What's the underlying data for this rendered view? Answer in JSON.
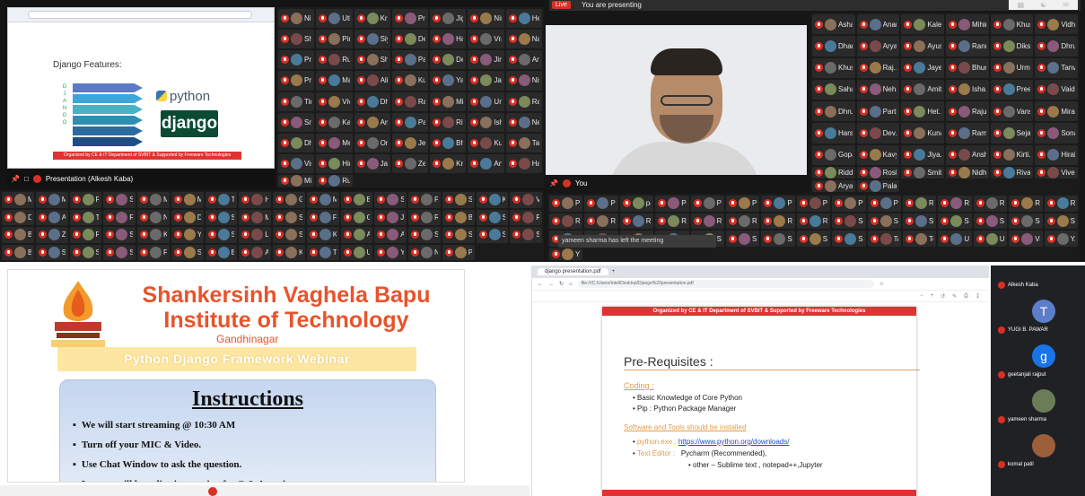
{
  "q1": {
    "slide_title": "Django Features:",
    "letters": [
      "D",
      "J",
      "A",
      "N",
      "G",
      "O"
    ],
    "arrow_colors": [
      "#5b7ac7",
      "#3ba6d8",
      "#47b3c5",
      "#2f8fb2",
      "#2c6aa0",
      "#1f4e86"
    ],
    "python_label": "python",
    "django_label": "django",
    "footer": "Organized by CE & IT Department of SVBIT & Supported by Freeware Technologies",
    "presentation_label": "Presentation (Alkesh Kaba)",
    "participants": [
      "Nikhil...",
      "Utkal...",
      "Kria...",
      "Pratas...",
      "Jigar...",
      "Nimit...",
      "Hetal...",
      "Sheja...",
      "Pinal...",
      "Siya...",
      "Deep...",
      "Harsh...",
      "Vraj...",
      "Nand...",
      "Pran...",
      "Rush...",
      "Shah...",
      "Patel...",
      "Dev...",
      "Jinal...",
      "Anish...",
      "Priy...",
      "Mahi...",
      "Alia...",
      "Kush...",
      "Yash...",
      "Jay...",
      "Nisha...",
      "Tirth...",
      "Vivek...",
      "Dhaval...",
      "Raj...",
      "Mitesh...",
      "Urvi...",
      "Rahul...",
      "Sneha...",
      "Karan...",
      "Aman...",
      "Parth...",
      "Riya...",
      "Ishan...",
      "Neel...",
      "Dhruv...",
      "Meet...",
      "Om...",
      "Jeel...",
      "Bhavik...",
      "Kunal...",
      "Tanya...",
      "Vishal...",
      "Hiren...",
      "Janvi...",
      "Zeel...",
      "Krish...",
      "Ankit...",
      "Harsh...",
      "Mitul...",
      "Rudra..."
    ],
    "bottom_participants": [
      "Man...",
      "MAN...",
      "Ram...",
      "Suhas...",
      "MAN...",
      "MAN...",
      "Thaul...",
      "Hemy...",
      "Gavest...",
      "MUCH...",
      "Bhosal...",
      "SOCH...",
      "PAVIT...",
      "SOCH...",
      "KAIMLI...",
      "Vivek...",
      "Drish...",
      "Ayush...",
      "Tarun...",
      "Ritik...",
      "Nirav...",
      "Devi...",
      "Sahil...",
      "Mansi...",
      "Sweta...",
      "Foram...",
      "Gauri...",
      "Jinal...",
      "Ronak...",
      "Bhumi...",
      "Surv...",
      "Rajat...",
      "Bawr...",
      "ZAK...",
      "Ritesh...",
      "SHAK...",
      "Kinjal...",
      "Yash...",
      "SUB...",
      "Lach...",
      "Sanil...",
      "Kevin...",
      "Arya...",
      "Akash...",
      "Shivu...",
      "Shrel...",
      "Stav...",
      "SHR...",
      "Boot...",
      "Shild...",
      "Shrit...",
      "Samir...",
      "Fahe...",
      "Sima...",
      "Bhavi...",
      "Amit...",
      "Kruti...",
      "Tirth...",
      "Ujvi...",
      "Yoshi...",
      "Nirali...",
      "Parth..."
    ]
  },
  "q2": {
    "live_label": "Live",
    "presenting": "You are presenting",
    "you_label": "You",
    "toast": "yameen sharma has left the meeting",
    "participants": [
      "Asha...",
      "Anand...",
      "Kalesh...",
      "Mihir...",
      "Khushi...",
      "Vidhi...",
      "Dhar...",
      "Arya...",
      "Ayush...",
      "Ranu...",
      "Diksha...",
      "Dhruvi...",
      "Khush...",
      "Raj...",
      "Jayesh...",
      "Bhumi...",
      "Urmi...",
      "Tanvi...",
      "Sahaj...",
      "Neha...",
      "Amit...",
      "Isha...",
      "Preet...",
      "Vaid...",
      "Dhruv...",
      "Parth...",
      "Het...",
      "Raju...",
      "Vanshi...",
      "Mira...",
      "Harsh...",
      "Dev...",
      "Kunal...",
      "Ramesh...",
      "Sejal...",
      "Sonal...",
      "Gopal...",
      "Kavya...",
      "Jiya...",
      "Ansh...",
      "Kirti...",
      "Hiral...",
      "Riddhi...",
      "Roshni...",
      "Smit...",
      "Nidhi...",
      "Riva...",
      "Vivek...",
      "Aryan...",
      "Palak..."
    ],
    "bottom": [
      "Parth L...",
      "Patel K...",
      "patel s...",
      "Patel Y...",
      "Prak...",
      "PRAKR...",
      "Prerna...",
      "Pratiksha...",
      "PRATI...",
      "Preethi...",
      "RATH...",
      "Radhika...",
      "Raju S...",
      "Rakesh...",
      "Rahul...",
      "Rahul...",
      "Rahul...",
      "Raval...",
      "Rohan...",
      "Ritika...",
      "Roshni...",
      "Rudra...",
      "Rushi...",
      "Sachin...",
      "Saloni...",
      "Sanjay...",
      "Samir...",
      "Salee...",
      "Sejal...",
      "Shah...",
      "Shivani...",
      "Shrey...",
      "Shraddha...",
      "Shubh...",
      "Smit...",
      "Sneha...",
      "Sonam...",
      "Sunny...",
      "Suresh...",
      "Tanvi...",
      "Tejas...",
      "Unnati...",
      "Urvish...",
      "Vivek...",
      "YASH...",
      "Yatri..."
    ]
  },
  "q3": {
    "title_line1": "Shankersinh Vaghela Bapu",
    "title_line2": "Institute of Technology",
    "city": "Gandhinagar",
    "banner": "Python Django Framework Webinar",
    "instructions_title": "Instructions",
    "items": [
      "We will start streaming @ 10:30 AM",
      "Turn off your MIC & Video.",
      "Use Chat Window to ask the question.",
      "Last we will have live interaction for Q & A session."
    ]
  },
  "q4": {
    "tab_title": "django presentation.pdf",
    "url": "file:///C:/Users/Intel/Desktop/Django%20presentation.pdf",
    "org": "Organized by CE & IT Department of SVBIT & Supported by Freeware Technologies",
    "pre_title": "Pre-Requisites :",
    "coding_label": "Coding :",
    "coding_items": [
      "Basic Knowledge of Core Python",
      "Pip : Python Package Manager"
    ],
    "software_label": "Software and Tools should be installed",
    "python_exe": "python.exe :",
    "python_url": "https://www.python.org/downloads/",
    "text_editor": "Text Editor :",
    "pycharm": "Pycharm (Recommended),",
    "other": "other – Sublime text , notepad++,Jupyter",
    "side_participants": [
      {
        "name": "Alkesh Kaba",
        "avatar": "",
        "color": "#3a3a3a"
      },
      {
        "name": "YUGI B. PAWAR",
        "avatar": "T",
        "color": "#5c7ec9"
      },
      {
        "name": "geetanjali rajput",
        "avatar": "g",
        "color": "#1a73e8"
      },
      {
        "name": "yameen sharma",
        "avatar": "",
        "color": "#6b7d58"
      },
      {
        "name": "komal patil",
        "avatar": "",
        "color": "#9c5f3a"
      }
    ]
  }
}
